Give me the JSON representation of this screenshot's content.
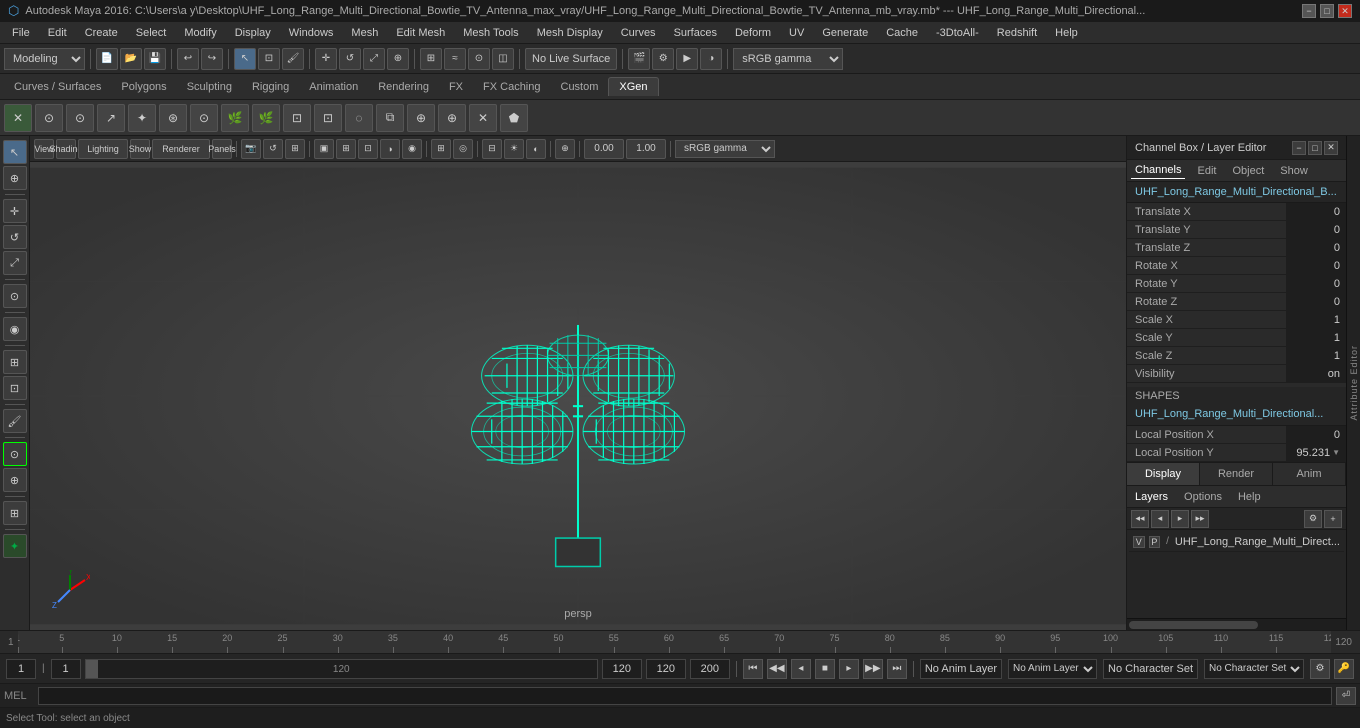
{
  "titlebar": {
    "title": "Autodesk Maya 2016: C:\\Users\\a y\\Desktop\\UHF_Long_Range_Multi_Directional_Bowtie_TV_Antenna_max_vray/UHF_Long_Range_Multi_Directional_Bowtie_TV_Antenna_mb_vray.mb* --- UHF_Long_Range_Multi_Directional...",
    "minimize": "−",
    "maximize": "□",
    "close": "✕"
  },
  "menubar": {
    "items": [
      "File",
      "Edit",
      "Create",
      "Select",
      "Modify",
      "Display",
      "Windows",
      "Mesh",
      "Edit Mesh",
      "Mesh Tools",
      "Mesh Display",
      "Curves",
      "Surfaces",
      "Deform",
      "UV",
      "Generate",
      "Cache",
      "-3DtoAll-",
      "Redshift",
      "Help"
    ]
  },
  "toolbar1": {
    "mode_select": "Modeling",
    "no_live_surface": "No Live Surface"
  },
  "shelf": {
    "tabs": [
      "Curves / Surfaces",
      "Polygons",
      "Sculpting",
      "Rigging",
      "Animation",
      "Rendering",
      "FX",
      "FX Caching",
      "Custom",
      "XGen"
    ],
    "active_tab": "XGen"
  },
  "viewport": {
    "menu": [
      "View",
      "Shading",
      "Lighting",
      "Show",
      "Renderer",
      "Panels"
    ],
    "camera_label": "persp",
    "color_space": "sRGB gamma",
    "value1": "0.00",
    "value2": "1.00"
  },
  "channel_box": {
    "title": "Channel Box / Layer Editor",
    "tabs": [
      "Channels",
      "Edit",
      "Object",
      "Show"
    ],
    "object_name": "UHF_Long_Range_Multi_Directional_B...",
    "channels": [
      {
        "label": "Translate X",
        "value": "0"
      },
      {
        "label": "Translate Y",
        "value": "0"
      },
      {
        "label": "Translate Z",
        "value": "0"
      },
      {
        "label": "Rotate X",
        "value": "0"
      },
      {
        "label": "Rotate Y",
        "value": "0"
      },
      {
        "label": "Rotate Z",
        "value": "0"
      },
      {
        "label": "Scale X",
        "value": "1"
      },
      {
        "label": "Scale Y",
        "value": "1"
      },
      {
        "label": "Scale Z",
        "value": "1"
      },
      {
        "label": "Visibility",
        "value": "on"
      }
    ],
    "shapes_title": "SHAPES",
    "shapes_item": "UHF_Long_Range_Multi_Directional...",
    "local_position_x_label": "Local Position X",
    "local_position_x_value": "0",
    "local_position_y_label": "Local Position Y",
    "local_position_y_value": "95.231"
  },
  "display_tabs": {
    "tabs": [
      "Display",
      "Render",
      "Anim"
    ],
    "active": "Display"
  },
  "layer_tabs": {
    "tabs": [
      "Layers",
      "Options",
      "Help"
    ],
    "active": "Layers"
  },
  "layer_list": {
    "items": [
      {
        "vis": "V",
        "type": "P",
        "name": "UHF_Long_Range_Multi_Direct..."
      }
    ]
  },
  "attr_strip": {
    "label": "Attribute Editor"
  },
  "timeline": {
    "ticks": [
      "1",
      "5",
      "10",
      "15",
      "20",
      "25",
      "30",
      "35",
      "40",
      "45",
      "50",
      "55",
      "60",
      "65",
      "70",
      "75",
      "80",
      "85",
      "90",
      "95",
      "100",
      "105",
      "110",
      "115",
      "120"
    ]
  },
  "playback": {
    "current_frame": "1",
    "range_start": "1",
    "range_end": "120",
    "range_end2": "120",
    "speed": "200",
    "no_anim_layer": "No Anim Layer",
    "no_character_set": "No Character Set",
    "frame_indicator": "1"
  },
  "command_line": {
    "label": "MEL",
    "placeholder": ""
  },
  "status_bar": {
    "text": "Select Tool: select an object"
  },
  "icons": {
    "select": "↖",
    "move": "✛",
    "rotate": "↺",
    "scale": "⤢",
    "undo": "↩",
    "redo": "↪",
    "grid": "⊞",
    "camera": "📷",
    "settings": "⚙",
    "play": "▶",
    "play_back": "◀",
    "stop": "■",
    "first_frame": "⏮",
    "last_frame": "⏭",
    "prev_frame": "⏪",
    "next_frame": "⏩",
    "step_back": "◂",
    "step_fwd": "▸"
  }
}
